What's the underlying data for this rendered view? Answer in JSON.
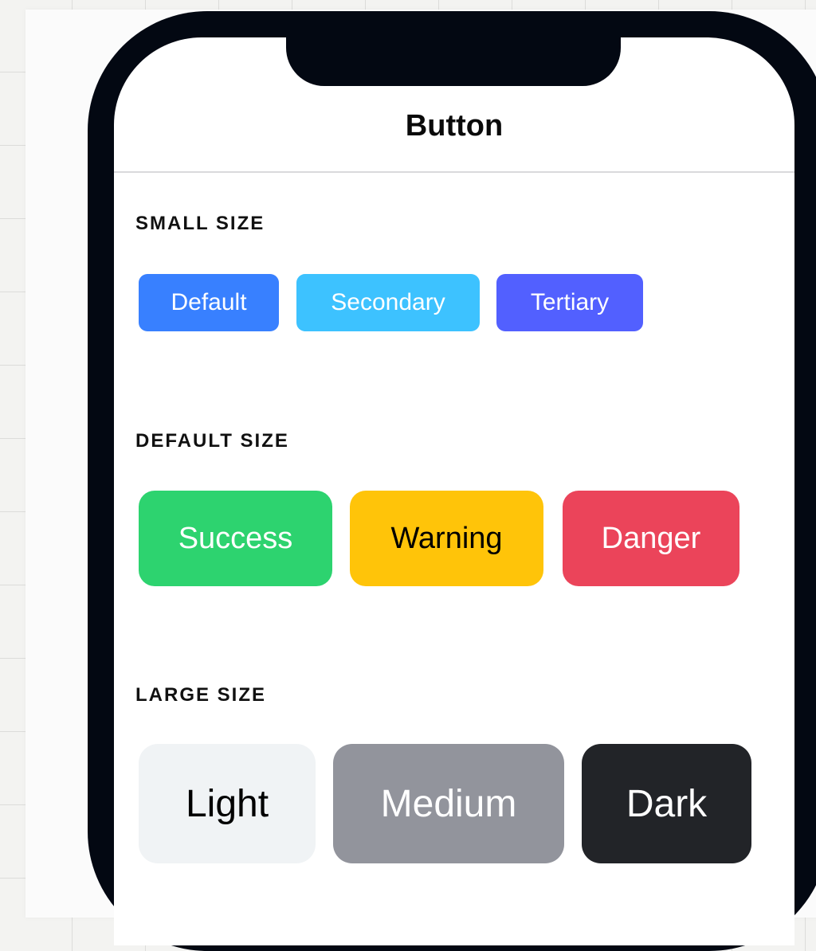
{
  "nav": {
    "title": "Button"
  },
  "sections": {
    "small": {
      "label": "SMALL SIZE",
      "buttons": [
        {
          "label": "Default",
          "bg": "#3880ff",
          "fg": "#ffffff"
        },
        {
          "label": "Secondary",
          "bg": "#3dc2ff",
          "fg": "#ffffff"
        },
        {
          "label": "Tertiary",
          "bg": "#5260ff",
          "fg": "#ffffff"
        }
      ]
    },
    "default": {
      "label": "DEFAULT SIZE",
      "buttons": [
        {
          "label": "Success",
          "bg": "#2dd36f",
          "fg": "#ffffff"
        },
        {
          "label": "Warning",
          "bg": "#ffc409",
          "fg": "#000000"
        },
        {
          "label": "Danger",
          "bg": "#eb445a",
          "fg": "#ffffff"
        }
      ]
    },
    "large": {
      "label": "LARGE SIZE",
      "buttons": [
        {
          "label": "Light",
          "bg": "#f0f3f5",
          "fg": "#000000"
        },
        {
          "label": "Medium",
          "bg": "#92949c",
          "fg": "#ffffff"
        },
        {
          "label": "Dark",
          "bg": "#222428",
          "fg": "#ffffff"
        }
      ]
    }
  },
  "colors": {
    "phone_frame": "#030812",
    "screen_bg": "#ffffff",
    "divider": "#d9d9dc"
  }
}
